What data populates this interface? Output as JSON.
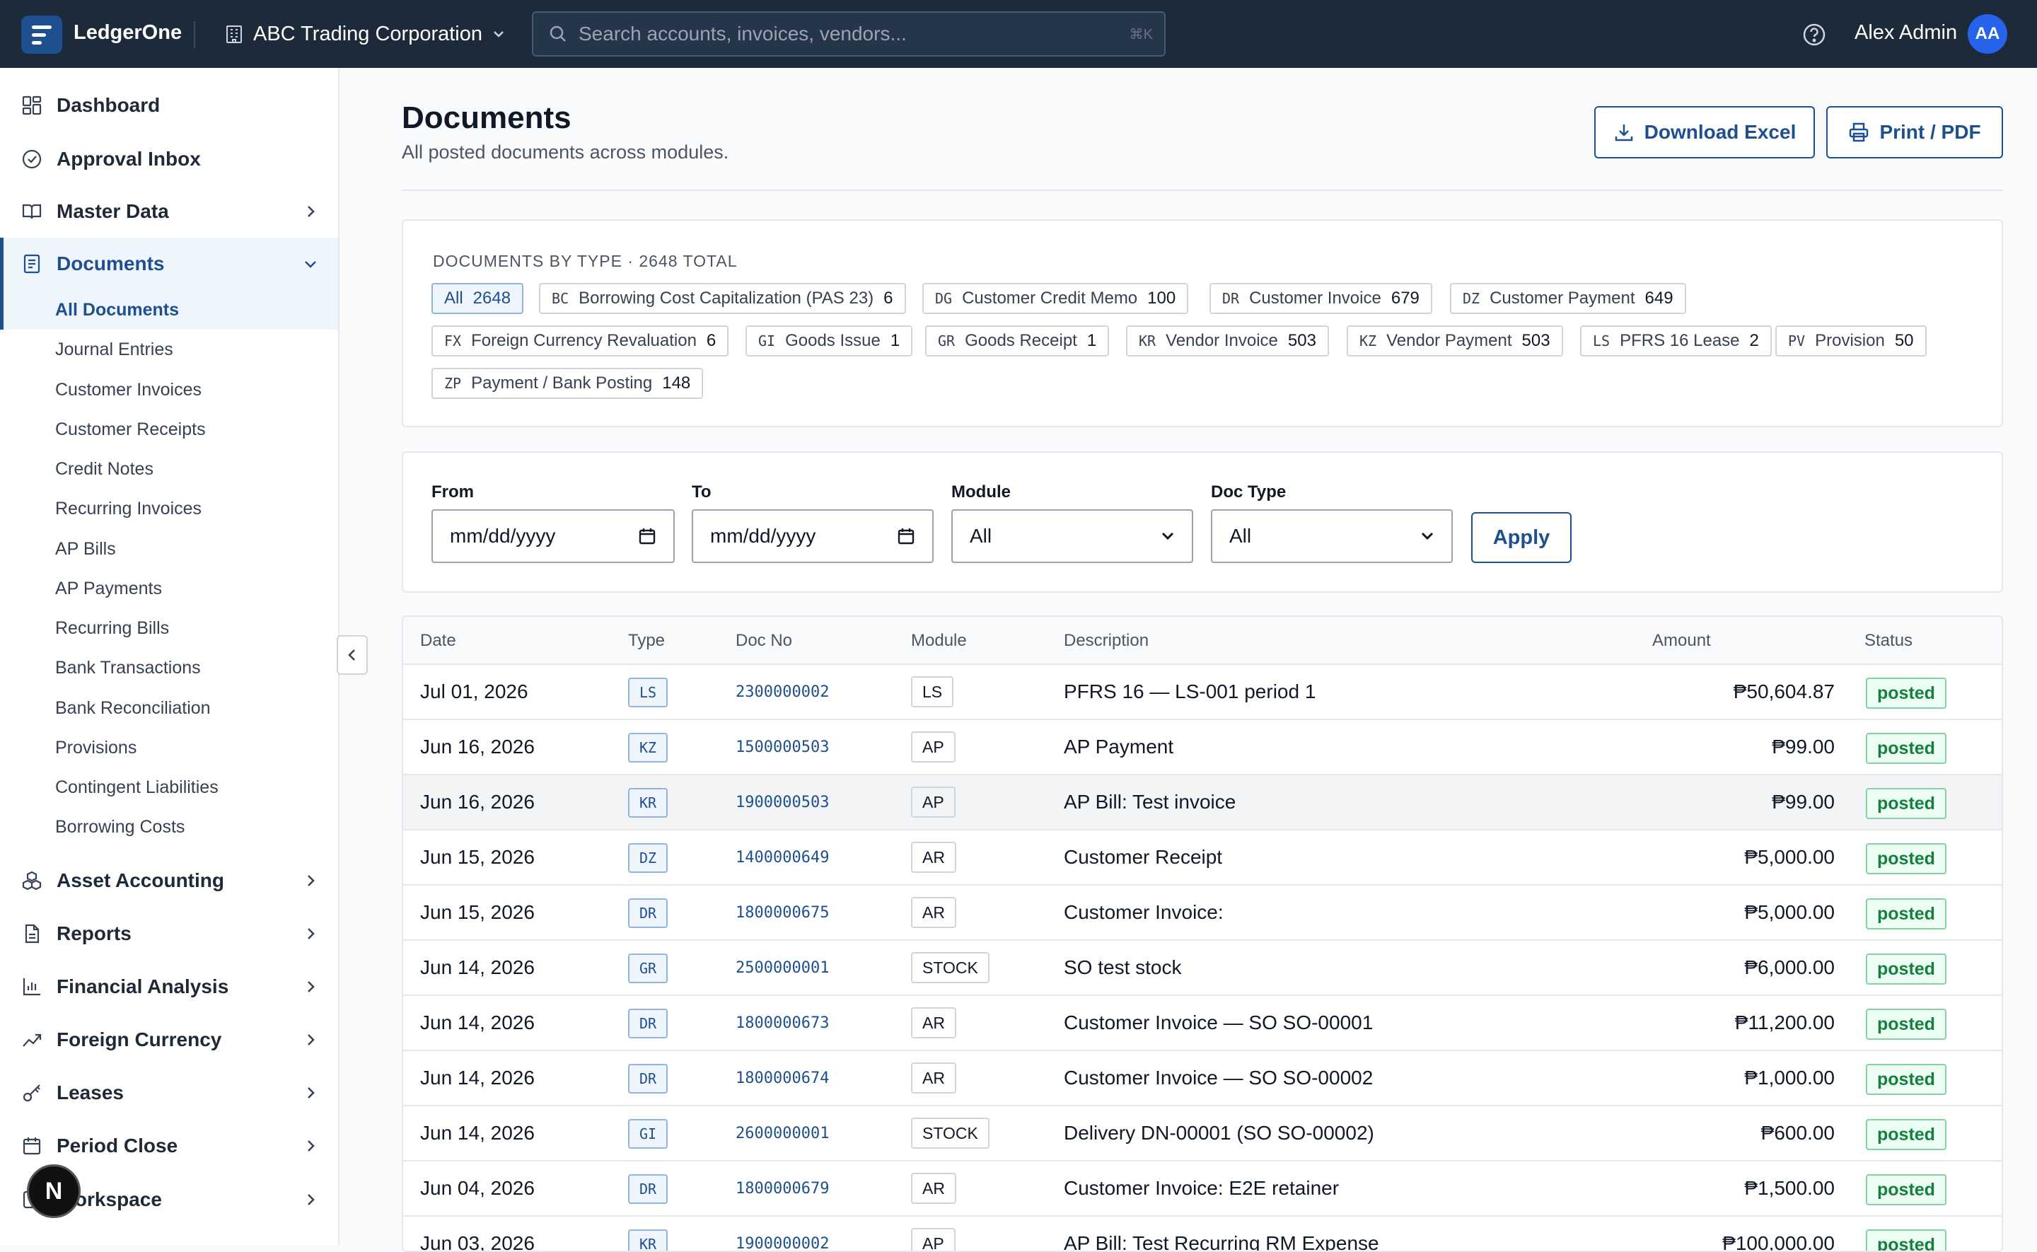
{
  "app": {
    "brand": "LedgerOne",
    "company": "ABC Trading Corporation",
    "search_placeholder": "Search accounts, invoices, vendors...",
    "search_shortcut": "⌘K",
    "user_name": "Alex Admin",
    "user_initials": "AA"
  },
  "sidebar": {
    "dashboard": "Dashboard",
    "approval_inbox": "Approval Inbox",
    "master_data": "Master Data",
    "documents": "Documents",
    "sub_items": [
      "All Documents",
      "Journal Entries",
      "Customer Invoices",
      "Customer Receipts",
      "Credit Notes",
      "Recurring Invoices",
      "AP Bills",
      "AP Payments",
      "Recurring Bills",
      "Bank Transactions",
      "Bank Reconciliation",
      "Provisions",
      "Contingent Liabilities",
      "Borrowing Costs"
    ],
    "asset_accounting": "Asset Accounting",
    "reports": "Reports",
    "financial_analysis": "Financial Analysis",
    "foreign_currency": "Foreign Currency",
    "leases": "Leases",
    "period_close": "Period Close",
    "workspace": "Workspace",
    "fab_letter": "N"
  },
  "header": {
    "title": "Documents",
    "subtitle": "All posted documents across modules.",
    "download_label": "Download Excel",
    "print_label": "Print / PDF"
  },
  "types_card": {
    "title": "DOCUMENTS BY TYPE · 2648 TOTAL",
    "chips": [
      {
        "code": "",
        "label": "All",
        "count": "2648"
      },
      {
        "code": "BC",
        "label": "Borrowing Cost Capitalization (PAS 23)",
        "count": "6"
      },
      {
        "code": "DG",
        "label": "Customer Credit Memo",
        "count": "100"
      },
      {
        "code": "DR",
        "label": "Customer Invoice",
        "count": "679"
      },
      {
        "code": "DZ",
        "label": "Customer Payment",
        "count": "649"
      },
      {
        "code": "FX",
        "label": "Foreign Currency Revaluation",
        "count": "6"
      },
      {
        "code": "GI",
        "label": "Goods Issue",
        "count": "1"
      },
      {
        "code": "GR",
        "label": "Goods Receipt",
        "count": "1"
      },
      {
        "code": "KR",
        "label": "Vendor Invoice",
        "count": "503"
      },
      {
        "code": "KZ",
        "label": "Vendor Payment",
        "count": "503"
      },
      {
        "code": "LS",
        "label": "PFRS 16 Lease",
        "count": "2"
      },
      {
        "code": "PV",
        "label": "Provision",
        "count": "50"
      },
      {
        "code": "ZP",
        "label": "Payment / Bank Posting",
        "count": "148"
      }
    ]
  },
  "filters": {
    "from_label": "From",
    "from_value": "mm/dd/yyyy",
    "to_label": "To",
    "to_value": "mm/dd/yyyy",
    "module_label": "Module",
    "module_value": "All",
    "doctype_label": "Doc Type",
    "doctype_value": "All",
    "apply_label": "Apply"
  },
  "table": {
    "columns": {
      "date": "Date",
      "type": "Type",
      "doc_no": "Doc No",
      "module": "Module",
      "description": "Description",
      "amount": "Amount",
      "status": "Status"
    },
    "rows": [
      {
        "date": "Jul 01, 2026",
        "type": "LS",
        "doc_no": "2300000002",
        "module": "LS",
        "description": "PFRS 16 — LS-001 period 1",
        "amount": "₱50,604.87",
        "status": "posted"
      },
      {
        "date": "Jun 16, 2026",
        "type": "KZ",
        "doc_no": "1500000503",
        "module": "AP",
        "description": "AP Payment",
        "amount": "₱99.00",
        "status": "posted"
      },
      {
        "date": "Jun 16, 2026",
        "type": "KR",
        "doc_no": "1900000503",
        "module": "AP",
        "description": "AP Bill: Test invoice",
        "amount": "₱99.00",
        "status": "posted"
      },
      {
        "date": "Jun 15, 2026",
        "type": "DZ",
        "doc_no": "1400000649",
        "module": "AR",
        "description": "Customer Receipt",
        "amount": "₱5,000.00",
        "status": "posted"
      },
      {
        "date": "Jun 15, 2026",
        "type": "DR",
        "doc_no": "1800000675",
        "module": "AR",
        "description": "Customer Invoice:",
        "amount": "₱5,000.00",
        "status": "posted"
      },
      {
        "date": "Jun 14, 2026",
        "type": "GR",
        "doc_no": "2500000001",
        "module": "STOCK",
        "description": "SO test stock",
        "amount": "₱6,000.00",
        "status": "posted"
      },
      {
        "date": "Jun 14, 2026",
        "type": "DR",
        "doc_no": "1800000673",
        "module": "AR",
        "description": "Customer Invoice — SO SO-00001",
        "amount": "₱11,200.00",
        "status": "posted"
      },
      {
        "date": "Jun 14, 2026",
        "type": "DR",
        "doc_no": "1800000674",
        "module": "AR",
        "description": "Customer Invoice — SO SO-00002",
        "amount": "₱1,000.00",
        "status": "posted"
      },
      {
        "date": "Jun 14, 2026",
        "type": "GI",
        "doc_no": "2600000001",
        "module": "STOCK",
        "description": "Delivery DN-00001 (SO SO-00002)",
        "amount": "₱600.00",
        "status": "posted"
      },
      {
        "date": "Jun 04, 2026",
        "type": "DR",
        "doc_no": "1800000679",
        "module": "AR",
        "description": "Customer Invoice: E2E retainer",
        "amount": "₱1,500.00",
        "status": "posted"
      },
      {
        "date": "Jun 03, 2026",
        "type": "KR",
        "doc_no": "1900000002",
        "module": "AP",
        "description": "AP Bill: Test Recurring RM Expense",
        "amount": "₱100,000.00",
        "status": "posted"
      }
    ]
  }
}
